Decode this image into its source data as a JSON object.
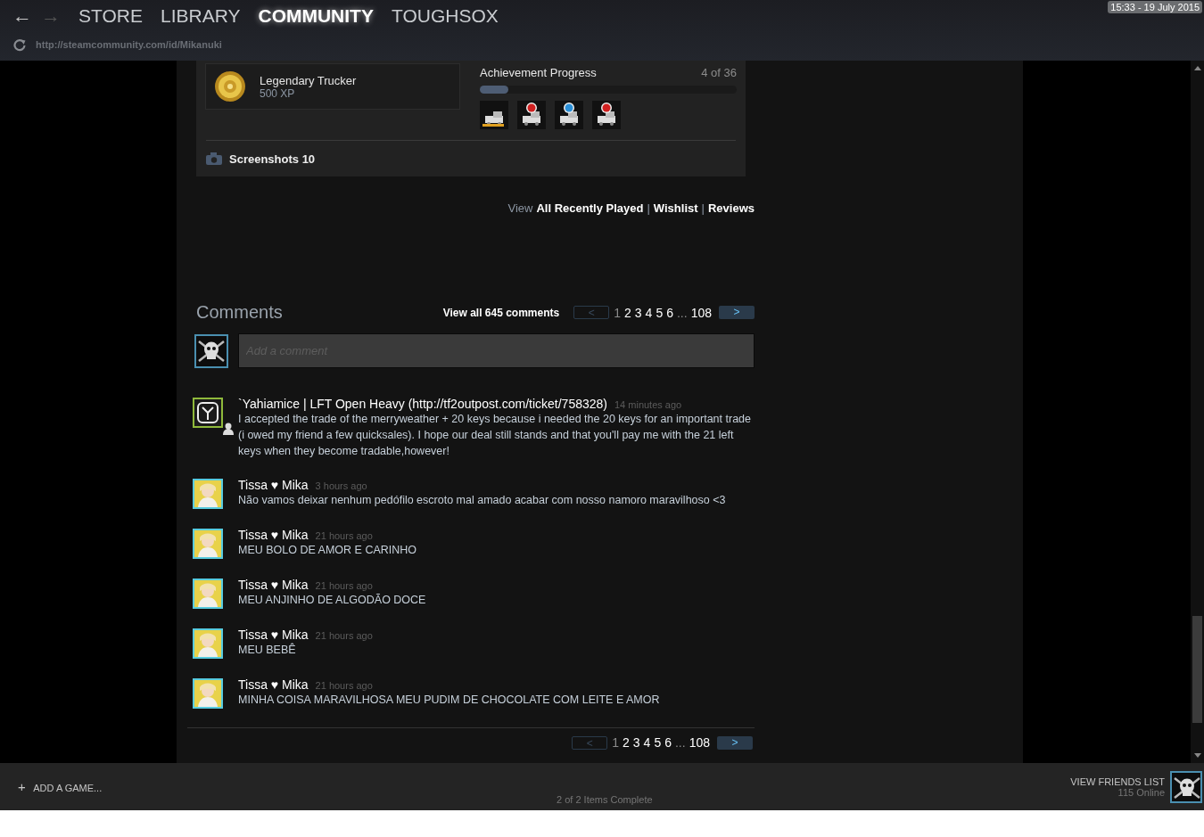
{
  "nav": {
    "back": "←",
    "forward": {
      "label": "→",
      "disabled": true
    },
    "tabs": [
      {
        "label": "STORE",
        "selected": false
      },
      {
        "label": "LIBRARY",
        "selected": false
      },
      {
        "label": "COMMUNITY",
        "selected": true
      },
      {
        "label": "TOUGHSOX",
        "selected": false
      }
    ],
    "url": "http://steamcommunity.com/id/Mikanuki",
    "clock": "15:33 - 19 July 2015"
  },
  "game": {
    "achievement": {
      "name": "Legendary Trucker",
      "xp": "500 XP"
    },
    "progress": {
      "title": "Achievement Progress",
      "count": "4 of 36",
      "level": 0.11
    },
    "achievements": [
      {
        "kind": "cargo"
      },
      {
        "kind": "sign",
        "color": "#d02020"
      },
      {
        "kind": "sign",
        "color": "#2a8fd8"
      },
      {
        "kind": "sign",
        "color": "#d02020"
      }
    ],
    "screenshots": "Screenshots 10"
  },
  "links": {
    "prefix": "View",
    "items": [
      "All Recently Played",
      "Wishlist",
      "Reviews"
    ],
    "separator": "|"
  },
  "comments": {
    "title": "Comments",
    "view_all": "View all 645 comments",
    "pager": {
      "prev": "<",
      "next": ">",
      "pages": [
        {
          "label": "1",
          "selected": true
        },
        {
          "label": "2",
          "selected": false
        },
        {
          "label": "3",
          "selected": false
        },
        {
          "label": "4",
          "selected": false
        },
        {
          "label": "5",
          "selected": false
        },
        {
          "label": "6",
          "selected": false
        },
        {
          "label": "...",
          "kind": "ellipsis"
        },
        {
          "label": "108",
          "selected": false
        }
      ]
    },
    "placeholder": "Add a comment",
    "items": [
      {
        "author": "`Yahiamice | LFT Open Heavy (http://tf2outpost.com/ticket/758328)",
        "time": "14 minutes ago",
        "text": "I accepted the trade of the merryweather + 20 keys because i needed the 20 keys for an important trade (i owed my friend a few quicksales). I hope our deal still stands and that you'll pay me with the 21 left keys when they become tradable,however!",
        "color": "#8fb93b",
        "badge": true
      },
      {
        "author": "Tissa ♥ Mika",
        "time": "3 hours ago",
        "text": "Não vamos deixar nenhum pedófilo escroto mal amado acabar com nosso namoro maravilhoso <3",
        "color": "#57cbde",
        "badge": false
      },
      {
        "author": "Tissa ♥ Mika",
        "time": "21 hours ago",
        "text": "MEU BOLO DE AMOR E CARINHO",
        "color": "#57cbde",
        "badge": false
      },
      {
        "author": "Tissa ♥ Mika",
        "time": "21 hours ago",
        "text": "MEU ANJINHO DE ALGODÃO DOCE",
        "color": "#57cbde",
        "badge": false
      },
      {
        "author": "Tissa ♥ Mika",
        "time": "21 hours ago",
        "text": "MEU BEBÊ",
        "color": "#57cbde",
        "badge": false
      },
      {
        "author": "Tissa ♥ Mika",
        "time": "21 hours ago",
        "text": "MINHA COISA MARAVILHOSA MEU PUDIM DE CHOCOLATE COM LEITE E AMOR",
        "color": "#57cbde",
        "badge": false
      }
    ],
    "bottom_pager": {
      "prev": "<",
      "next": ">",
      "pages": [
        {
          "label": "1",
          "selected": true
        },
        {
          "label": "2",
          "selected": false
        },
        {
          "label": "3",
          "selected": false
        },
        {
          "label": "4",
          "selected": false
        },
        {
          "label": "5",
          "selected": false
        },
        {
          "label": "6",
          "selected": false
        },
        {
          "label": "...",
          "kind": "ellipsis"
        },
        {
          "label": "108",
          "selected": false
        }
      ]
    }
  },
  "footer": {
    "add_game": "ADD A GAME...",
    "plus": "+",
    "status": "2 of 2 Items Complete",
    "friends": "VIEW FRIENDS LIST",
    "online": "115 Online"
  }
}
